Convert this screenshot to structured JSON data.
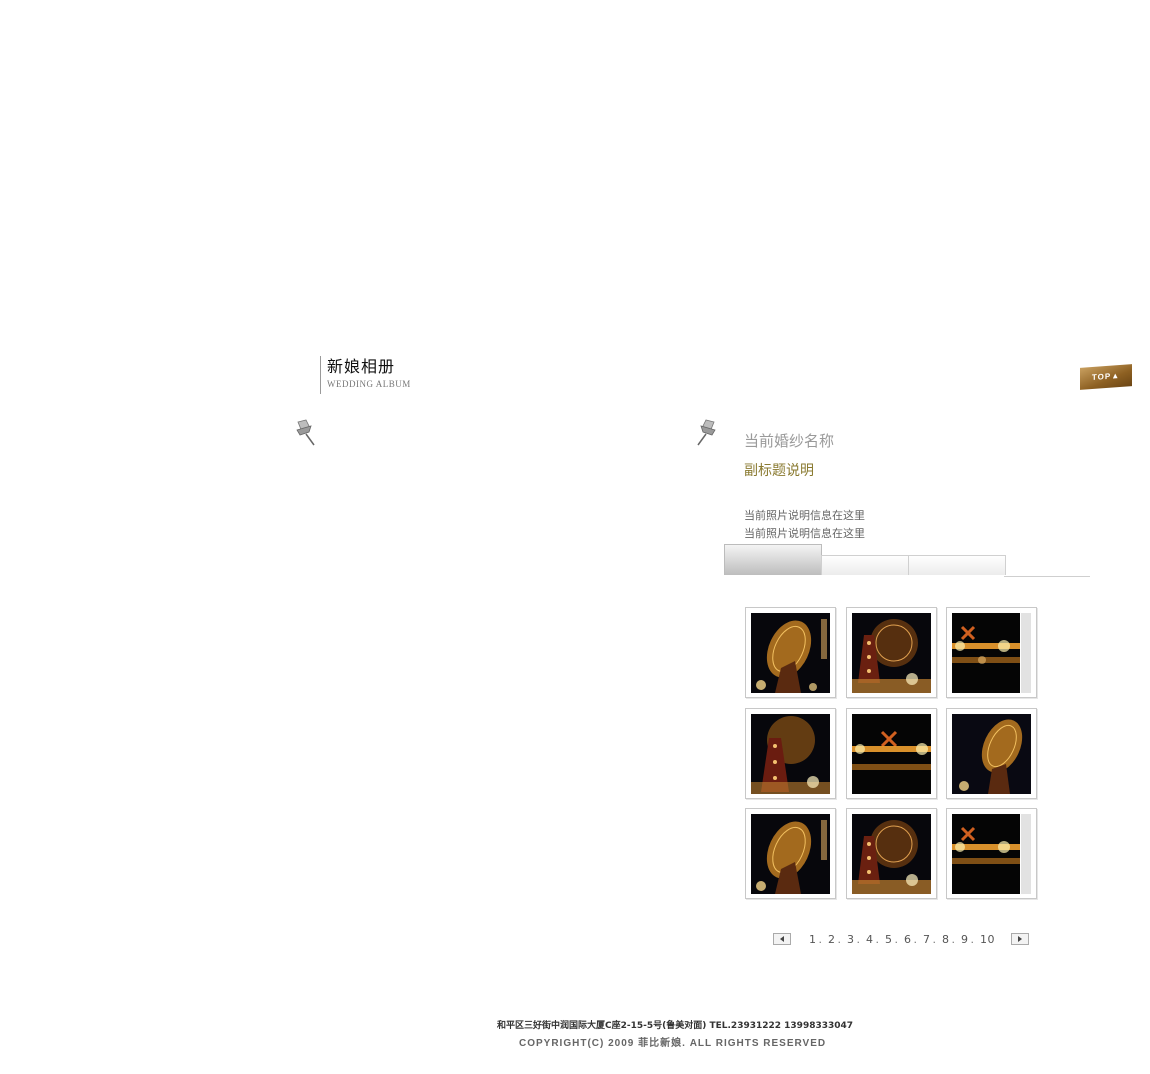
{
  "section": {
    "title_cn": "新娘相册",
    "title_en": "WEDDING ALBUM"
  },
  "top_button": {
    "label": "TOP▲"
  },
  "detail": {
    "dress_name": "当前婚纱名称",
    "subtitle": "副标题说明",
    "desc_line1": "当前照片说明信息在这里",
    "desc_line2": "当前照片说明信息在这里"
  },
  "tabs": [
    {
      "label": "",
      "active": true
    },
    {
      "label": "",
      "active": false
    },
    {
      "label": "",
      "active": false
    }
  ],
  "thumbnails": [
    {
      "icon": "ferris-wheel-photo"
    },
    {
      "icon": "ferris-wheel-photo"
    },
    {
      "icon": "windmill-lights-photo"
    },
    {
      "icon": "ferris-wheel-photo"
    },
    {
      "icon": "windmill-lights-photo"
    },
    {
      "icon": "ferris-wheel-photo"
    },
    {
      "icon": "ferris-wheel-photo"
    },
    {
      "icon": "ferris-wheel-photo"
    },
    {
      "icon": "windmill-lights-photo"
    }
  ],
  "pager": {
    "pages": [
      "1",
      "2",
      "3",
      "4",
      "5",
      "6",
      "7",
      "8",
      "9",
      "10"
    ]
  },
  "footer": {
    "address": "和平区三好街中润国际大厦C座2-15-5号(鲁美对面)  TEL.23931222 13998333047",
    "copyright": "COPYRIGHT(C) 2009 菲比新娘. ALL RIGHTS RESERVED"
  },
  "colors": {
    "accent_gold": "#8a6a2a",
    "subtitle": "#8a7a30"
  }
}
